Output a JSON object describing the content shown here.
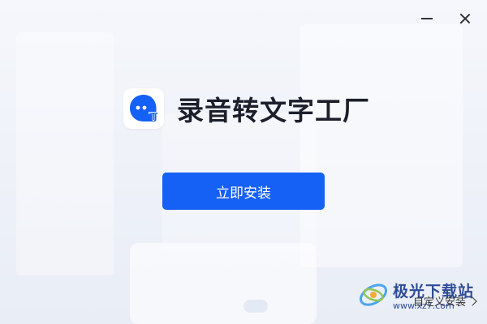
{
  "window": {
    "minimize_icon": "minimize-icon",
    "close_icon": "close-icon"
  },
  "app": {
    "title": "录音转文字工厂",
    "logo_icon": "chat-bubble-t-icon",
    "logo_color": "#1560f5"
  },
  "actions": {
    "install_label": "立即安装",
    "custom_install_label": "自定义安装",
    "custom_install_icon": "chevron-right-icon"
  },
  "watermark": {
    "title": "极光下载站",
    "url": "www.xz7.com"
  },
  "colors": {
    "primary": "#1560f5",
    "title_text": "#1c1f2b",
    "watermark": "#1f3f8f"
  }
}
